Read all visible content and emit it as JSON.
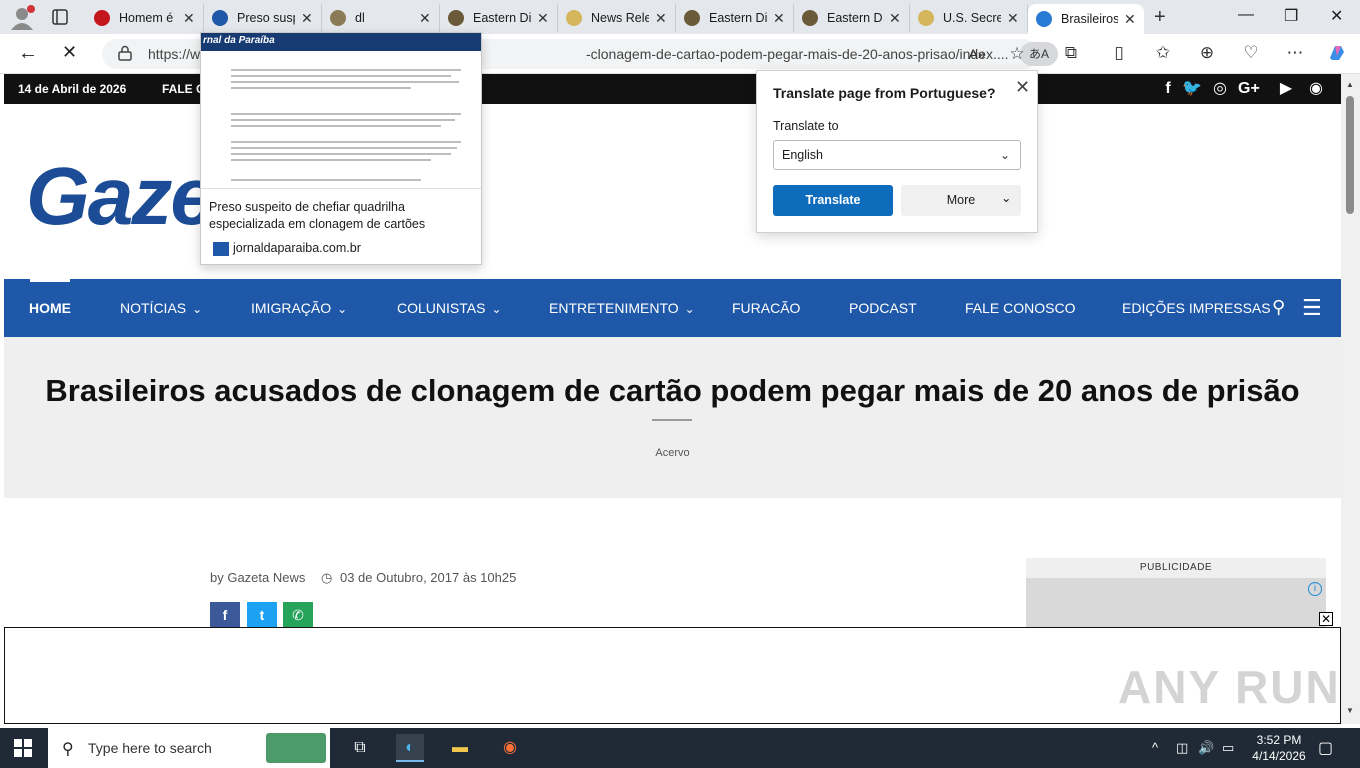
{
  "browser": {
    "tabs": [
      {
        "label": "Homem é",
        "favicon_color": "#c4161c"
      },
      {
        "label": "Preso susp",
        "favicon_color": "#1f58a8"
      },
      {
        "label": "dl",
        "favicon_color": "#8a7a55"
      },
      {
        "label": "Eastern Di",
        "favicon_color": "#6b5a3a"
      },
      {
        "label": "News Rele",
        "favicon_color": "#d6b65a"
      },
      {
        "label": "Eastern Di",
        "favicon_color": "#6b5a3a"
      },
      {
        "label": "Eastern Di",
        "favicon_color": "#6b5a3a"
      },
      {
        "label": "U.S. Secret",
        "favicon_color": "#d6b65a"
      },
      {
        "label": "Brasileiros",
        "favicon_color": "#2a7bd4"
      }
    ],
    "tab_close_glyph": "✕",
    "new_tab_glyph": "+",
    "window_controls": {
      "minimize": "—",
      "maximize": "❐",
      "close": "✕"
    },
    "url_left": "https://w",
    "url_right": "-clonagem-de-cartao-podem-pegar-mais-de-20-anos-prisao/index....",
    "translate_badge": "あA",
    "read_aloud": "A»",
    "icons": {
      "back": "back-arrow-icon",
      "reload": "stop-icon",
      "lock": "lock-icon",
      "favorite": "star-icon",
      "extensions": "puzzle-icon",
      "split": "split-screen-icon",
      "favorites": "favorites-icon",
      "collections": "collections-icon",
      "performance": "heart-pulse-icon",
      "menu": "more-icon",
      "copilot": "copilot-icon"
    }
  },
  "tab_preview": {
    "thumb_logo": "rnal da Paraíba",
    "title": "Preso suspeito de chefiar quadrilha especializada em clonagem de cartões",
    "site": "jornaldaparaiba.com.br"
  },
  "translate_popup": {
    "title": "Translate page from Portuguese?",
    "translate_to_label": "Translate to",
    "selected_language": "English",
    "translate_button": "Translate",
    "more_button": "More",
    "close_glyph": "✕",
    "chevron_glyph": "⌄"
  },
  "site": {
    "date": "14 de Abril de 2026",
    "top_link": "FALE C",
    "social": [
      {
        "name": "facebook-icon",
        "glyph": "f"
      },
      {
        "name": "twitter-icon",
        "glyph": "🐦"
      },
      {
        "name": "instagram-icon",
        "glyph": "◎"
      },
      {
        "name": "google-plus-icon",
        "glyph": "G+"
      },
      {
        "name": "youtube-icon",
        "glyph": "▶"
      },
      {
        "name": "rss-icon",
        "glyph": "◉"
      }
    ],
    "logo_text": "Gazet",
    "nav": [
      {
        "label": "HOME",
        "bold": true,
        "dropdown": false
      },
      {
        "label": "NOTÍCIAS",
        "bold": false,
        "dropdown": true
      },
      {
        "label": "IMIGRAÇÃO",
        "bold": false,
        "dropdown": true
      },
      {
        "label": "COLUNISTAS",
        "bold": false,
        "dropdown": true
      },
      {
        "label": "ENTRETENIMENTO",
        "bold": false,
        "dropdown": true
      },
      {
        "label": "FURACÃO",
        "bold": false,
        "dropdown": false
      },
      {
        "label": "PODCAST",
        "bold": false,
        "dropdown": false
      },
      {
        "label": "FALE CONOSCO",
        "bold": false,
        "dropdown": false
      },
      {
        "label": "EDIÇÕES IMPRESSAS",
        "bold": false,
        "dropdown": false
      }
    ],
    "dropdown_glyph": "⌄",
    "search_glyph": "⚲",
    "menu_glyph": "☰",
    "headline": "Brasileiros acusados de clonagem de cartão podem pegar mais de 20 anos de prisão",
    "image_caption": "Acervo",
    "byline_author": "by Gazeta News",
    "byline_date": "03 de Outubro, 2017 às 10h25",
    "clock_glyph": "◷",
    "share": [
      {
        "name": "facebook-share-button",
        "glyph": "f",
        "color": "#3b5998"
      },
      {
        "name": "twitter-share-button",
        "glyph": "t",
        "color": "#1da1f2"
      },
      {
        "name": "whatsapp-share-button",
        "glyph": "✆",
        "color": "#25a45a"
      }
    ],
    "ad_label": "PUBLICIDADE",
    "ad_info_glyph": "i",
    "ad_close_glyph": "✕",
    "watermark": "ANY RUN"
  },
  "taskbar": {
    "search_placeholder": "Type here to search",
    "time": "3:52 PM",
    "date": "4/14/2026",
    "apps": [
      {
        "name": "task-view-icon",
        "glyph": "⧉"
      },
      {
        "name": "edge-icon",
        "glyph": "◐"
      },
      {
        "name": "file-explorer-icon",
        "glyph": "▬"
      },
      {
        "name": "firefox-icon",
        "glyph": "◉"
      }
    ],
    "tray": {
      "chevron": "^",
      "meet": "◫",
      "volume": "🔊",
      "network": "▭",
      "notifications": "▢"
    }
  }
}
